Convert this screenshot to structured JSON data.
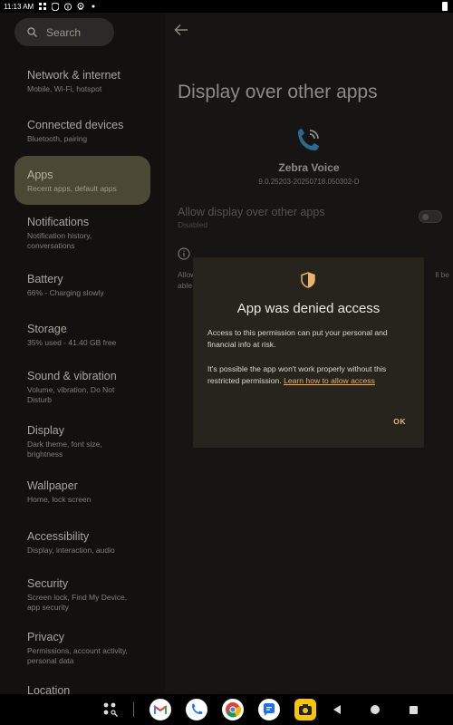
{
  "status_bar": {
    "time": "11:13 AM"
  },
  "sidebar": {
    "search_placeholder": "Search",
    "items": [
      {
        "title": "Network & internet",
        "sub": "Mobile, Wi-Fi, hotspot"
      },
      {
        "title": "Connected devices",
        "sub": "Bluetooth, pairing"
      },
      {
        "title": "Apps",
        "sub": "Recent apps, default apps",
        "selected": true
      },
      {
        "title": "Notifications",
        "sub": "Notification history, conversations"
      },
      {
        "title": "Battery",
        "sub": "66% - Charging slowly"
      },
      {
        "title": "Storage",
        "sub": "35% used - 41.40 GB free"
      },
      {
        "title": "Sound & vibration",
        "sub": "Volume, vibration, Do Not Disturb"
      },
      {
        "title": "Display",
        "sub": "Dark theme, font size, brightness"
      },
      {
        "title": "Wallpaper",
        "sub": "Home, lock screen"
      },
      {
        "title": "Accessibility",
        "sub": "Display, interaction, audio"
      },
      {
        "title": "Security",
        "sub": "Screen lock, Find My Device, app security"
      },
      {
        "title": "Privacy",
        "sub": "Permissions, account activity, personal data"
      },
      {
        "title": "Location",
        "sub": ""
      }
    ]
  },
  "main": {
    "title": "Display over other apps",
    "app_name": "Zebra Voice",
    "app_version": "9.0.25203-20250718.050302-D",
    "toggle_label": "Allow display over other apps",
    "toggle_sub": "Disabled",
    "toggle_on": false,
    "info_text_left": "Allow",
    "info_text_left2": "able",
    "info_text_right": "ll be"
  },
  "dialog": {
    "title": "App was denied access",
    "body1": "Access to this permission can put your personal and financial info at risk.",
    "body2": "It's possible the app won't work properly without this restricted permission.",
    "link": "Learn how to allow access",
    "ok": "OK",
    "accent": "#ebb26b"
  },
  "taskbar": {
    "apps": [
      "app-drawer-icon",
      "gmail-icon",
      "phone-icon",
      "chrome-icon",
      "messages-icon",
      "camera-icon"
    ],
    "nav": [
      "back-icon",
      "home-icon",
      "recents-icon"
    ]
  }
}
